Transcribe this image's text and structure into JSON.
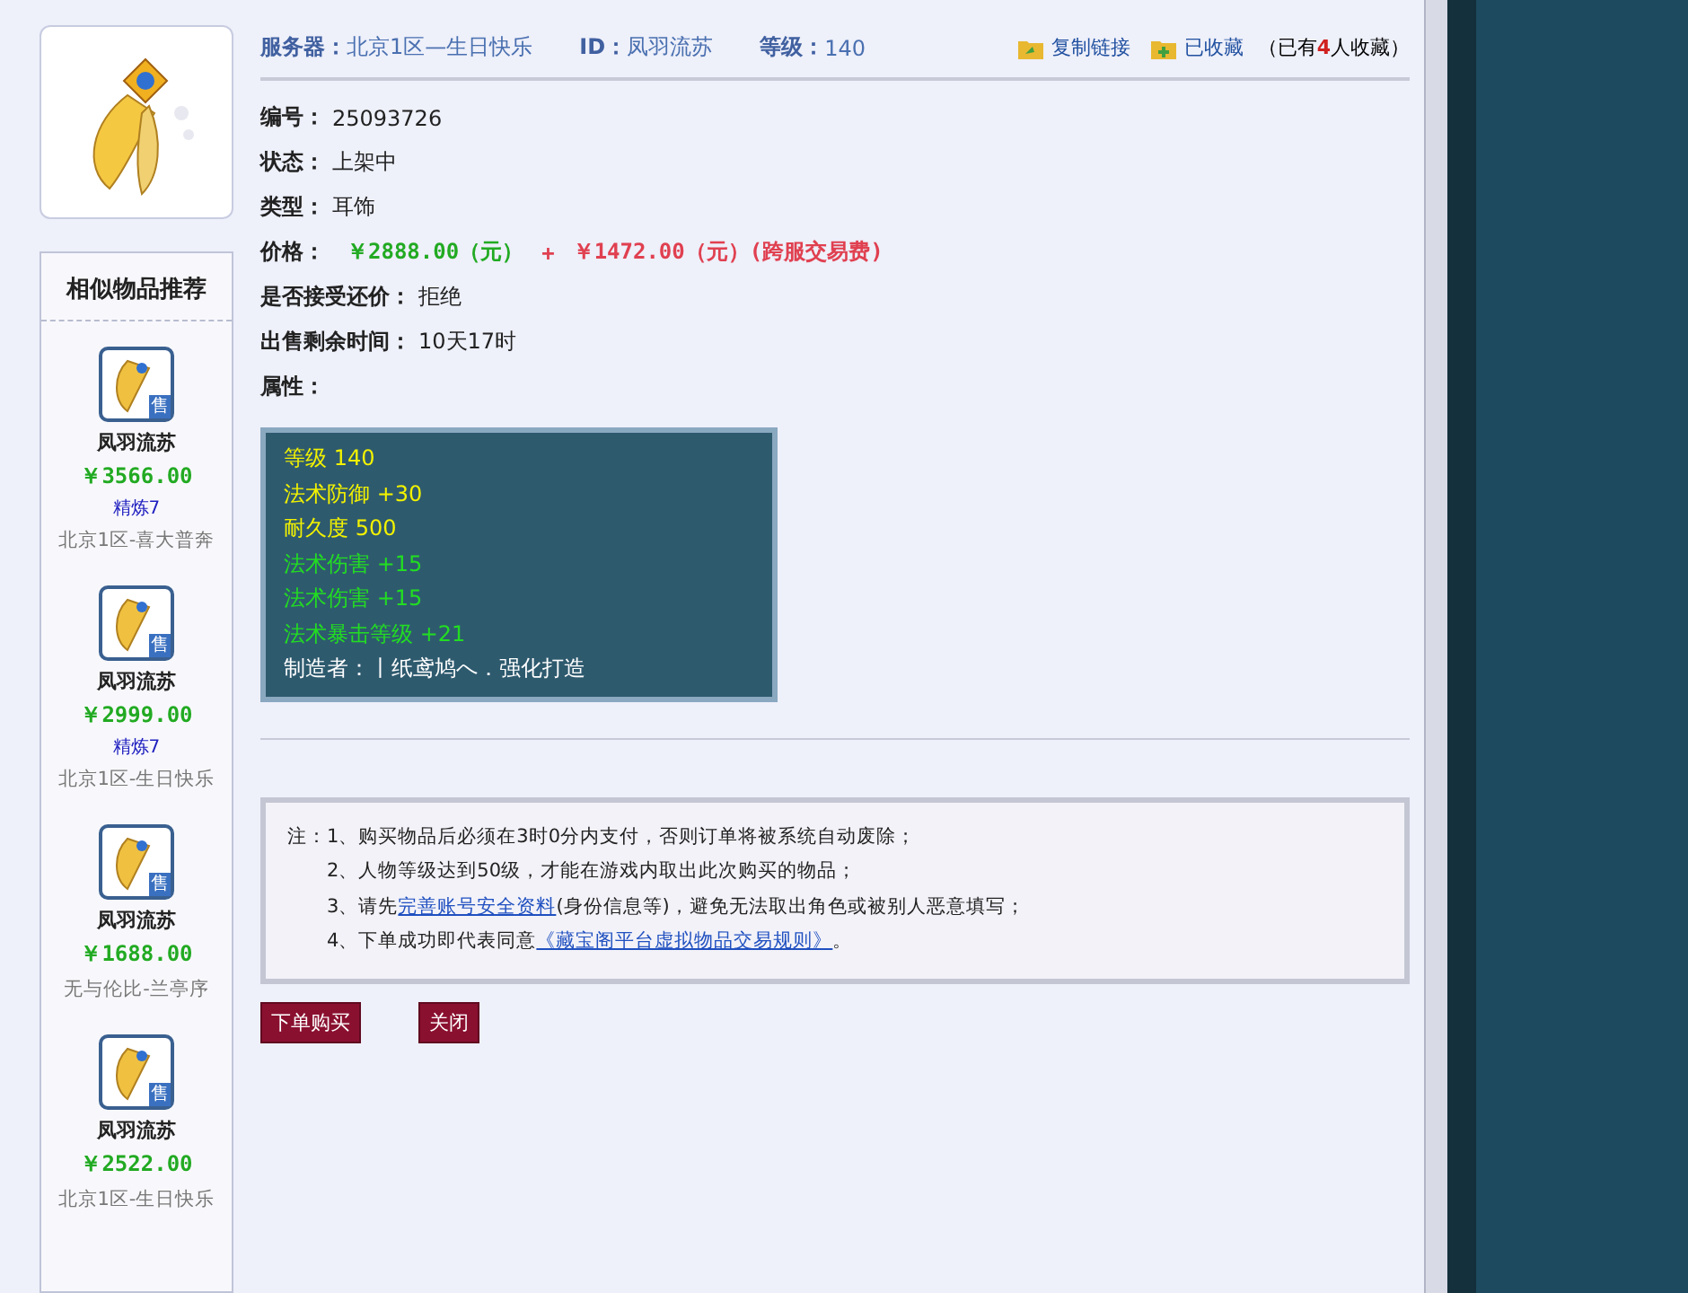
{
  "header": {
    "server_label": "服务器：",
    "server": "北京1区—生日快乐",
    "id_label": "ID：",
    "id": "凤羽流苏",
    "level_label": "等级：",
    "level": "140",
    "copy_link": "复制链接",
    "favorite": "已收藏",
    "favorites": {
      "before": "（已有",
      "count": "4",
      "after": "人收藏）"
    }
  },
  "fields": [
    {
      "label": "编号：",
      "value": "25093726",
      "kind": "plain"
    },
    {
      "label": "状态：",
      "value": "上架中",
      "kind": "plain"
    },
    {
      "label": "类型：",
      "value": "耳饰",
      "kind": "plain"
    },
    {
      "label": "价格：",
      "value": "￥2888.00（元）",
      "plus": "+",
      "fee": "￥1472.00（元）(跨服交易费)",
      "kind": "price"
    },
    {
      "label": "是否接受还价：",
      "value": "拒绝",
      "kind": "plain"
    },
    {
      "label": "出售剩余时间：",
      "value": "10天17时",
      "kind": "plain"
    },
    {
      "label": "属性：",
      "kind": "plain"
    }
  ],
  "attributes": [
    {
      "text": "等级 140",
      "color": "#f2f200"
    },
    {
      "text": "法术防御 +30",
      "color": "#f2f200"
    },
    {
      "text": "耐久度 500",
      "color": "#f2f200"
    },
    {
      "text": "法术伤害 +15",
      "color": "#22dd22"
    },
    {
      "text": "法术伤害 +15",
      "color": "#22dd22"
    },
    {
      "text": "法术暴击等级 +21",
      "color": "#22dd22"
    },
    {
      "text": "制造者：丨纸鸢鸠へ．强化打造",
      "color": "#ffffff"
    }
  ],
  "notes": [
    {
      "prefix": "注：",
      "before": "1、购买物品后必须在3时0分内支付，否则订单将被系统自动废除；"
    },
    {
      "before": "2、人物等级达到50级，才能在游戏内取出此次购买的物品；"
    },
    {
      "before": "3、请先",
      "link": "完善账号安全资料",
      "after": "(身份信息等)，避免无法取出角色或被别人恶意填写；"
    },
    {
      "before": "4、下单成功即代表同意",
      "link": "《藏宝阁平台虚拟物品交易规则》",
      "after": "。"
    }
  ],
  "buttons": [
    "下单购买",
    "关闭"
  ],
  "sidebar": {
    "title": "相似物品推荐",
    "items": [
      {
        "badge": "售",
        "name": "凤羽流苏",
        "price": "￥3566.00",
        "refine": "精炼7",
        "server": "北京1区-喜大普奔"
      },
      {
        "badge": "售",
        "name": "凤羽流苏",
        "price": "￥2999.00",
        "refine": "精炼7",
        "server": "北京1区-生日快乐"
      },
      {
        "badge": "售",
        "name": "凤羽流苏",
        "price": "￥1688.00",
        "server": "无与伦比-兰亭序"
      },
      {
        "badge": "售",
        "name": "凤羽流苏",
        "price": "￥2522.00",
        "server": "北京1区-生日快乐"
      }
    ]
  }
}
